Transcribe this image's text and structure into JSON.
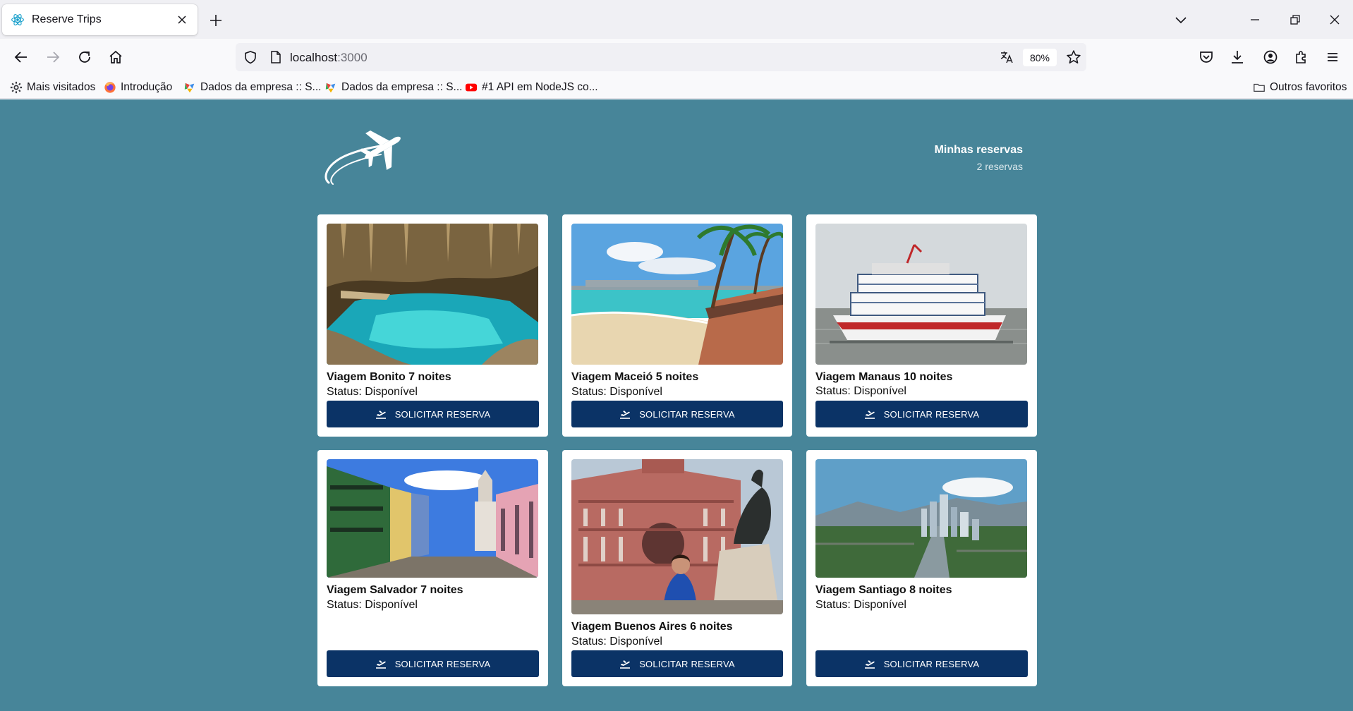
{
  "browser": {
    "tab_title": "Reserve Trips",
    "url_host": "localhost",
    "url_port": ":3000",
    "zoom": "80%",
    "bookmarks": [
      {
        "label": "Mais visitados",
        "icon": "gear-icon"
      },
      {
        "label": "Introdução",
        "icon": "firefox-icon"
      },
      {
        "label": "Dados da empresa :: S...",
        "icon": "colorful-app-icon"
      },
      {
        "label": "Dados da empresa :: S...",
        "icon": "colorful-app-icon"
      },
      {
        "label": "#1 API em NodeJS co...",
        "icon": "youtube-icon"
      }
    ],
    "other_bookmarks": "Outros favoritos"
  },
  "header": {
    "reservas_title": "Minhas reservas",
    "reservas_count": "2 reservas"
  },
  "trips": [
    {
      "title": "Viagem Bonito 7 noites",
      "status": "Status: Disponível",
      "button": "SOLICITAR RESERVA",
      "image": "cave-lake-photo"
    },
    {
      "title": "Viagem Maceió 5 noites",
      "status": "Status: Disponível",
      "button": "SOLICITAR RESERVA",
      "image": "beach-photo"
    },
    {
      "title": "Viagem Manaus 10 noites",
      "status": "Status: Disponível",
      "button": "SOLICITAR RESERVA",
      "image": "riverboat-photo"
    },
    {
      "title": "Viagem Salvador 7 noites",
      "status": "Status: Disponível",
      "button": "SOLICITAR RESERVA",
      "image": "colonial-street-photo"
    },
    {
      "title": "Viagem Buenos Aires 6 noites",
      "status": "Status: Disponível",
      "button": "SOLICITAR RESERVA",
      "image": "casa-rosada-photo"
    },
    {
      "title": "Viagem Santiago 8 noites",
      "status": "Status: Disponível",
      "button": "SOLICITAR RESERVA",
      "image": "city-skyline-photo"
    }
  ],
  "colors": {
    "page_background": "#478599",
    "button": "#0b3366",
    "card": "#ffffff"
  }
}
